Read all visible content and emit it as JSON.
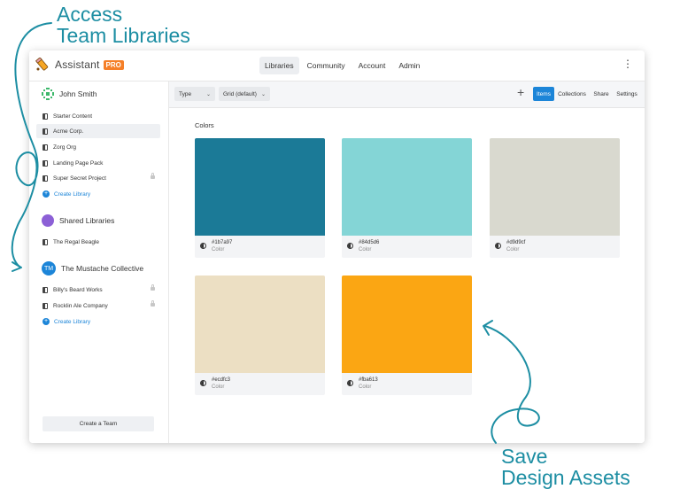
{
  "annotations": {
    "top": [
      "Access",
      "Team Libraries"
    ],
    "bottom": [
      "Save",
      "Design Assets"
    ]
  },
  "app": {
    "name": "Assistant",
    "badge": "PRO"
  },
  "nav": {
    "items": [
      "Libraries",
      "Community",
      "Account",
      "Admin"
    ],
    "active": "Libraries",
    "menu_icon": "⋮"
  },
  "sidebar": {
    "teams": [
      {
        "name": "John Smith",
        "libraries": [
          {
            "label": "Starter Content",
            "locked": false
          },
          {
            "label": "Acme Corp.",
            "locked": false,
            "selected": true
          },
          {
            "label": "Zorg Org",
            "locked": false
          },
          {
            "label": "Landing Page Pack",
            "locked": false
          },
          {
            "label": "Super Secret Project",
            "locked": true
          }
        ],
        "create_label": "Create Library"
      },
      {
        "name": "Shared Libraries",
        "libraries": [
          {
            "label": "The Regal Beagle",
            "locked": false
          }
        ]
      },
      {
        "name": "The Mustache Collective",
        "initials": "TM",
        "libraries": [
          {
            "label": "Billy's Beard Works",
            "locked": true
          },
          {
            "label": "Rocklin Ale Company",
            "locked": true
          }
        ],
        "create_label": "Create Library"
      }
    ],
    "create_team_label": "Create a Team"
  },
  "toolbar": {
    "type_label": "Type",
    "view_label": "Grid (default)",
    "add_icon": "+",
    "tabs": [
      "Items",
      "Collections",
      "Share",
      "Settings"
    ],
    "active_tab": "Items"
  },
  "main": {
    "section_title": "Colors",
    "colors": [
      {
        "hex": "#1b7a97",
        "type": "Color"
      },
      {
        "hex": "#84d5d6",
        "type": "Color"
      },
      {
        "hex": "#d9d9cf",
        "type": "Color"
      },
      {
        "hex": "#ecdfc3",
        "type": "Color"
      },
      {
        "hex": "#fba613",
        "type": "Color"
      }
    ]
  },
  "colors": {
    "accent": "#1c85d8",
    "annotation": "#1d8ea3",
    "pro_badge": "#f57f28"
  }
}
